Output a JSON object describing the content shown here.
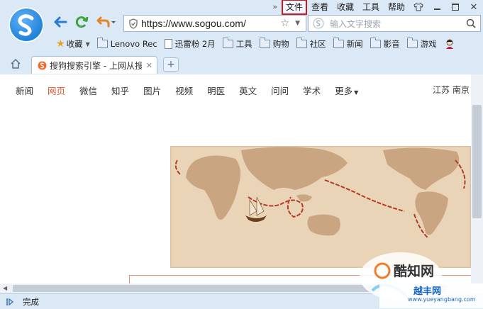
{
  "menubar": {
    "items": [
      "文件",
      "查看",
      "收藏",
      "工具",
      "帮助"
    ],
    "highlighted_index": 0
  },
  "address": {
    "url": "https://www.sogou.com/"
  },
  "search": {
    "placeholder": "输入文字搜索"
  },
  "bookmarks": {
    "favorites_label": "收藏",
    "items": [
      {
        "label": "Lenovo Rec",
        "icon": "folder-icon"
      },
      {
        "label": "迅雷粉 2月",
        "icon": "page-icon"
      },
      {
        "label": "工具",
        "icon": "folder-icon"
      },
      {
        "label": "购物",
        "icon": "folder-icon"
      },
      {
        "label": "社区",
        "icon": "folder-icon"
      },
      {
        "label": "新闻",
        "icon": "folder-icon"
      },
      {
        "label": "影音",
        "icon": "folder-icon"
      },
      {
        "label": "游戏",
        "icon": "folder-icon"
      }
    ]
  },
  "tab": {
    "title": "搜狗搜索引擎 - 上网从搜"
  },
  "page_nav": {
    "items": [
      "新闻",
      "网页",
      "微信",
      "知乎",
      "图片",
      "视频",
      "明医",
      "英文",
      "问问",
      "学术",
      "更多"
    ],
    "active_index": 1,
    "location": "江苏 南京"
  },
  "status": {
    "text": "完成"
  },
  "watermark": {
    "brand": "酷知网",
    "brand2": "越丰网",
    "url": "www.yueyangbang.com"
  },
  "colors": {
    "accent": "#e2542c",
    "highlight_border": "#d0161f",
    "chrome": "#dbe8f6"
  }
}
